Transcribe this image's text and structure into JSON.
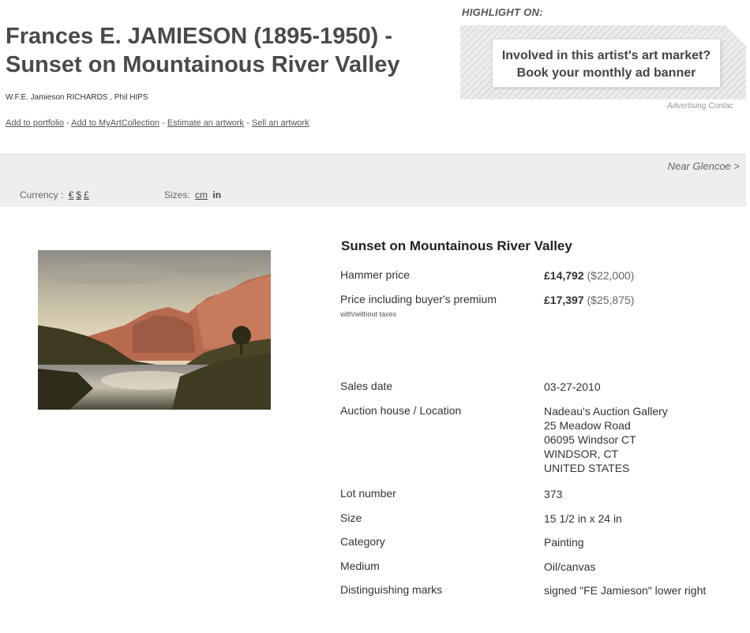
{
  "header": {
    "title_line1": "Frances E. JAMIESON (1895-1950) -",
    "title_line2": "Sunset on Mountainous River Valley",
    "related_artists": "W.F.E. Jamieson RICHARDS , Phil HIPS",
    "actions": [
      "Add to portfolio",
      "Add to MyArtCollection",
      "Estimate an artwork",
      "Sell an artwork"
    ],
    "action_separator": " - "
  },
  "ad": {
    "heading": "HIGHLIGHT ON:",
    "line1": "Involved in this artist's art market?",
    "line2": "Book your monthly ad banner",
    "contact": "Advertising Contac"
  },
  "toolbar": {
    "near_link": "Near Glencoe >",
    "currency_label": "Currency :",
    "currency_options": [
      "€",
      "$",
      "£"
    ],
    "sizes_label": "Sizes:",
    "size_options": [
      "cm",
      "in"
    ]
  },
  "lot": {
    "title": "Sunset on Mountainous River Valley",
    "hammer_label": "Hammer price",
    "hammer_value": "£14,792",
    "hammer_alt": "($22,000)",
    "premium_label": "Price including buyer's premium",
    "premium_value": "£17,397",
    "premium_alt": "($25,875)",
    "premium_note": "with/without taxes",
    "sales_date_label": "Sales date",
    "sales_date": "03-27-2010",
    "auction_label": "Auction house / Location",
    "auction_lines": [
      "Nadeau's Auction Gallery",
      "25 Meadow Road",
      "06095 Windsor CT",
      "WINDSOR, CT",
      "UNITED STATES"
    ],
    "lot_number_label": "Lot number",
    "lot_number": "373",
    "size_label": "Size",
    "size": "15 1/2 in x 24 in",
    "category_label": "Category",
    "category": "Painting",
    "medium_label": "Medium",
    "medium": "Oil/canvas",
    "marks_label": "Distinguishing marks",
    "marks": "signed \"FE Jamieson\" lower right"
  }
}
